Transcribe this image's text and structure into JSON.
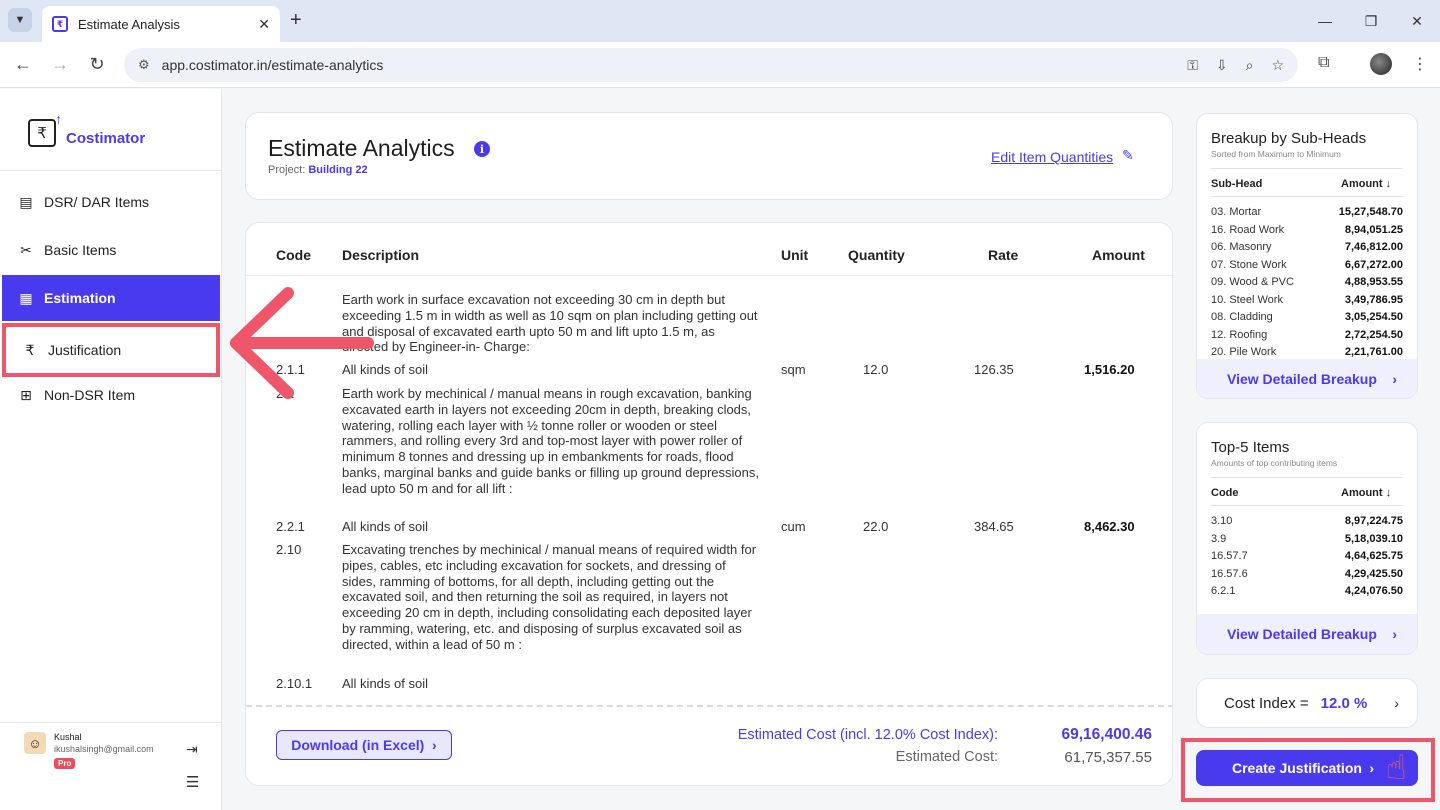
{
  "browser": {
    "tab_title": "Estimate Analysis",
    "url": "app.costimator.in/estimate-analytics"
  },
  "sidebar": {
    "brand": "Costimator",
    "items": [
      {
        "label": "DSR/ DAR Items",
        "icon": "table-icon"
      },
      {
        "label": "Basic Items",
        "icon": "tools-icon"
      },
      {
        "label": "Estimation",
        "icon": "calculator-icon"
      },
      {
        "label": "Justification",
        "icon": "rupee-icon"
      },
      {
        "label": "Non-DSR Item",
        "icon": "plus-box-icon"
      }
    ],
    "user": {
      "name": "Kushal",
      "email": "ikushalsingh@gmail.com",
      "badge": "Pro"
    }
  },
  "header": {
    "title": "Estimate Analytics",
    "project_label": "Project:",
    "project_name": "Building 22",
    "edit_link": "Edit Item Quantities"
  },
  "table": {
    "columns": [
      "Code",
      "Description",
      "Unit",
      "Quantity",
      "Rate",
      "Amount"
    ],
    "rows": [
      {
        "code": "",
        "description": "Earth work in surface excavation not exceeding 30 cm in depth but exceeding 1.5 m in width as well as 10 sqm on plan including getting out and disposal of excavated earth upto 50 m and lift upto 1.5 m, as directed by Engineer-in- Charge:",
        "unit": "",
        "quantity": "",
        "rate": "",
        "amount": ""
      },
      {
        "code": "2.1.1",
        "description": "All kinds of soil",
        "unit": "sqm",
        "quantity": "12.0",
        "rate": "126.35",
        "amount": "1,516.20"
      },
      {
        "code": "2.2",
        "description": "Earth work by mechinical / manual means in rough excavation, banking excavated earth in layers not exceeding 20cm in depth, breaking clods, watering, rolling each layer with ½ tonne roller or wooden or steel rammers, and rolling every 3rd and top-most layer with power roller of minimum 8 tonnes and dressing up in embankments for roads, flood banks, marginal banks and guide banks or filling up ground depressions, lead upto 50 m and for all lift  :",
        "unit": "",
        "quantity": "",
        "rate": "",
        "amount": ""
      },
      {
        "code": "2.2.1",
        "description": "All kinds of soil",
        "unit": "cum",
        "quantity": "22.0",
        "rate": "384.65",
        "amount": "8,462.30"
      },
      {
        "code": "2.10",
        "description": "Excavating trenches by mechinical / manual means of required width for pipes, cables, etc including excavation for sockets, and dressing of sides, ramming of bottoms, for all depth, including getting out the excavated soil, and then returning the soil as required, in layers not exceeding 20 cm in depth, including consolidating each deposited layer by ramming, watering, etc. and disposing of surplus excavated soil as directed, within a lead of 50 m :",
        "unit": "",
        "quantity": "",
        "rate": "",
        "amount": ""
      },
      {
        "code": "2.10.1",
        "description": "All kinds of soil",
        "unit": "",
        "quantity": "",
        "rate": "",
        "amount": ""
      }
    ],
    "download_label": "Download (in Excel)",
    "est_cost_incl_label": "Estimated Cost (incl. 12.0% Cost Index):",
    "est_cost_incl_value": "69,16,400.46",
    "est_cost_label": "Estimated Cost:",
    "est_cost_value": "61,75,357.55"
  },
  "subheads": {
    "title": "Breakup by Sub-Heads",
    "subtitle": "Sorted from Maximum to Minimum",
    "col1": "Sub-Head",
    "col2": "Amount",
    "rows": [
      {
        "name": "03. Mortar",
        "amount": "15,27,548.70"
      },
      {
        "name": "16. Road Work",
        "amount": "8,94,051.25"
      },
      {
        "name": "06. Masonry",
        "amount": "7,46,812.00"
      },
      {
        "name": "07. Stone Work",
        "amount": "6,67,272.00"
      },
      {
        "name": "09. Wood & PVC",
        "amount": "4,88,953.55"
      },
      {
        "name": "10. Steel Work",
        "amount": "3,49,786.95"
      },
      {
        "name": "08. Cladding",
        "amount": "3,05,254.50"
      },
      {
        "name": "12. Roofing",
        "amount": "2,72,254.50"
      },
      {
        "name": "20. Pile Work",
        "amount": "2,21,761.00"
      }
    ],
    "link": "View Detailed Breakup"
  },
  "top5": {
    "title": "Top-5 Items",
    "subtitle": "Amounts of top contributing items",
    "col1": "Code",
    "col2": "Amount",
    "rows": [
      {
        "code": "3.10",
        "amount": "8,97,224.75"
      },
      {
        "code": "3.9",
        "amount": "5,18,039.10"
      },
      {
        "code": "16.57.7",
        "amount": "4,64,625.75"
      },
      {
        "code": "16.57.6",
        "amount": "4,29,425.50"
      },
      {
        "code": "6.2.1",
        "amount": "4,24,076.50"
      }
    ],
    "link": "View Detailed Breakup"
  },
  "cost_index": {
    "label": "Cost Index =",
    "value": "12.0 %"
  },
  "create_button": "Create Justification",
  "colors": {
    "accent": "#4a3aee",
    "annotation": "#f0566a"
  }
}
